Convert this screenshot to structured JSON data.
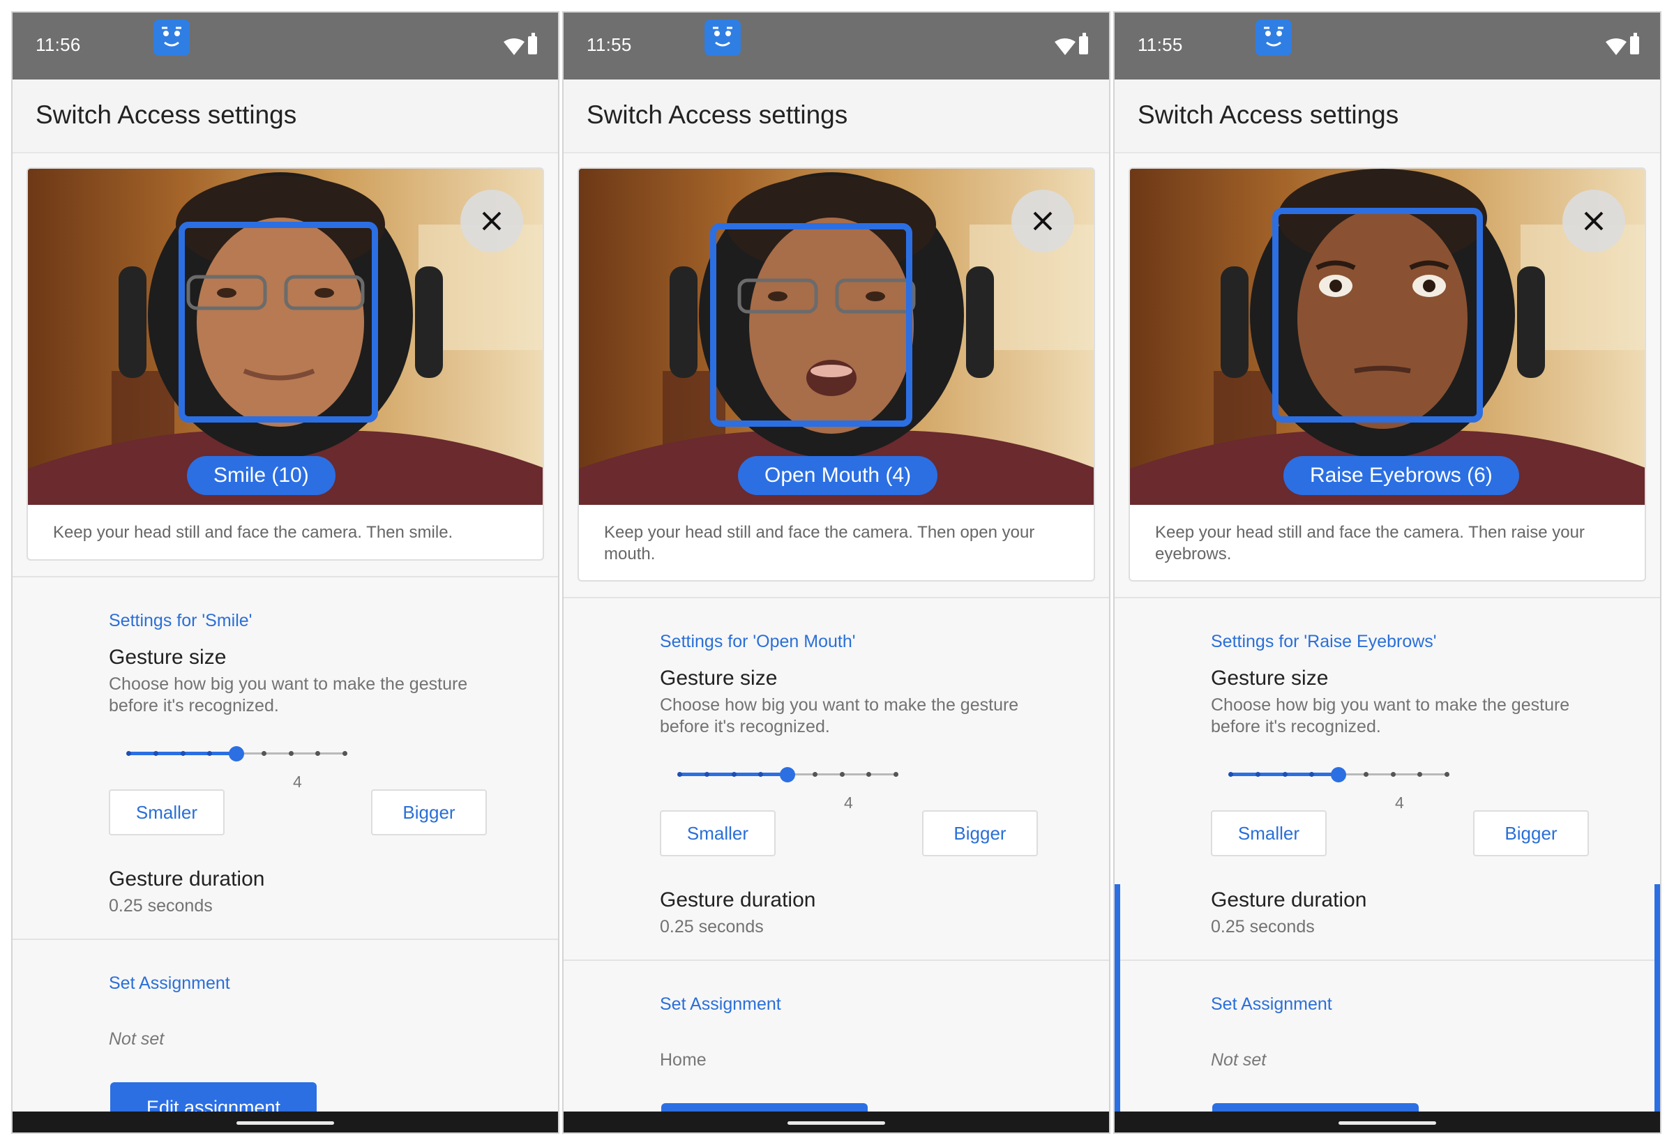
{
  "phones": [
    {
      "status_time": "11:56",
      "title": "Switch Access settings",
      "gesture_label": "Smile (10)",
      "instructions": "Keep your head still and face the camera. Then smile.",
      "settings_header": "Settings for 'Smile'",
      "gesture_size_title": "Gesture size",
      "gesture_size_summary": "Choose how big you want to make the gesture before it's recognized.",
      "slider_value": "4",
      "smaller_label": "Smaller",
      "bigger_label": "Bigger",
      "duration_title": "Gesture duration",
      "duration_value": "0.25 seconds",
      "assignment_header": "Set Assignment",
      "assignment_value": "Not set",
      "edit_button": "Edit assignment"
    },
    {
      "status_time": "11:55",
      "title": "Switch Access settings",
      "gesture_label": "Open Mouth (4)",
      "instructions": "Keep your head still and face the camera. Then open your mouth.",
      "settings_header": "Settings for 'Open Mouth'",
      "gesture_size_title": "Gesture size",
      "gesture_size_summary": "Choose how big you want to make the gesture before it's recognized.",
      "slider_value": "4",
      "smaller_label": "Smaller",
      "bigger_label": "Bigger",
      "duration_title": "Gesture duration",
      "duration_value": "0.25 seconds",
      "assignment_header": "Set Assignment",
      "assignment_value": "Home"
    },
    {
      "status_time": "11:55",
      "title": "Switch Access settings",
      "gesture_label": "Raise Eyebrows (6)",
      "instructions": "Keep your head still and face the camera. Then raise your eyebrows.",
      "settings_header": "Settings for 'Raise Eyebrows'",
      "gesture_size_title": "Gesture size",
      "gesture_size_summary": "Choose how big you want to make the gesture before it's recognized.",
      "slider_value": "4",
      "smaller_label": "Smaller",
      "bigger_label": "Bigger",
      "duration_title": "Gesture duration",
      "duration_value": "0.25 seconds",
      "assignment_header": "Set Assignment",
      "assignment_value": "Not set"
    }
  ],
  "slider": {
    "steps": 9,
    "selected_step": 5
  },
  "icons": {
    "status_app": "face-icon",
    "status_wifi": "wifi-icon",
    "status_battery": "battery-icon",
    "close": "close-icon"
  },
  "colors": {
    "accent": "#2b6fe3",
    "status_bar": "#6f6f6f",
    "link_text": "#2a6fd8"
  }
}
